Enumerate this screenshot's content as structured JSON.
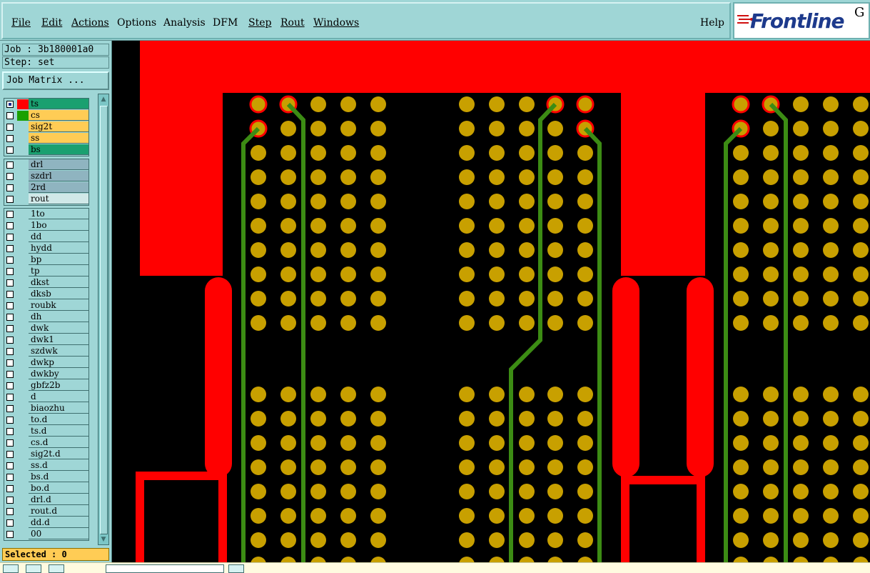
{
  "menu": {
    "items": [
      {
        "label": "File",
        "mnemonic": true
      },
      {
        "label": "Edit",
        "mnemonic": true
      },
      {
        "label": "Actions",
        "mnemonic": true
      },
      {
        "label": "Options",
        "mnemonic": false
      },
      {
        "label": "Analysis",
        "mnemonic": false
      },
      {
        "label": "DFM",
        "mnemonic": false
      },
      {
        "label": "Step",
        "mnemonic": true
      },
      {
        "label": "Rout",
        "mnemonic": true
      },
      {
        "label": "Windows",
        "mnemonic": true
      }
    ],
    "help_label": "Help"
  },
  "logo": {
    "text": "Frontline",
    "suffix": "G"
  },
  "info": {
    "job_line": "Job : 3b180001a0",
    "step_line": "Step: set",
    "job_matrix_label": "Job Matrix ..."
  },
  "layers": {
    "group1": [
      {
        "name": "ts",
        "bg": "#1aa070",
        "swatch": "#ff0000",
        "selected": true
      },
      {
        "name": "cs",
        "bg": "#ffcc55",
        "swatch": "#1aa000",
        "selected": false
      },
      {
        "name": "sig2t",
        "bg": "#ffcc55",
        "swatch": "",
        "selected": false
      },
      {
        "name": "ss",
        "bg": "#ffcc55",
        "swatch": "",
        "selected": false
      },
      {
        "name": "bs",
        "bg": "#1aa070",
        "swatch": "",
        "selected": false
      }
    ],
    "group2": [
      {
        "name": "drl",
        "bg": "#8fb4c0"
      },
      {
        "name": "szdrl",
        "bg": "#8fb4c0"
      },
      {
        "name": "2rd",
        "bg": "#8fb4c0"
      },
      {
        "name": "rout",
        "bg": "#d0e8e8"
      }
    ],
    "group3": [
      {
        "name": "1to"
      },
      {
        "name": "1bo"
      },
      {
        "name": "dd"
      },
      {
        "name": "hydd"
      },
      {
        "name": "bp"
      },
      {
        "name": "tp"
      },
      {
        "name": "dkst"
      },
      {
        "name": "dksb"
      },
      {
        "name": "roubk"
      },
      {
        "name": "dh"
      },
      {
        "name": "dwk"
      },
      {
        "name": "dwk1"
      },
      {
        "name": "szdwk"
      },
      {
        "name": "dwkp"
      },
      {
        "name": "dwkby"
      },
      {
        "name": "gbfz2b"
      },
      {
        "name": "d"
      },
      {
        "name": "biaozhu"
      },
      {
        "name": "to.d"
      },
      {
        "name": "ts.d"
      },
      {
        "name": "cs.d"
      },
      {
        "name": "sig2t.d"
      },
      {
        "name": "ss.d"
      },
      {
        "name": "bs.d"
      },
      {
        "name": "bo.d"
      },
      {
        "name": "drl.d"
      },
      {
        "name": "rout.d"
      },
      {
        "name": "dd.d"
      },
      {
        "name": "00"
      }
    ]
  },
  "status": {
    "selected_text": "Selected : 0"
  },
  "colors": {
    "panel_bg": "#9fd6d6",
    "copper": "#ff0000",
    "pad_fill": "#c8a000",
    "trace": "#3c8c14",
    "canvas_bg": "#000000"
  },
  "icons": {
    "logo_mark": "frontline-logo-icon",
    "scroll_up": "scroll-up-arrow-icon",
    "scroll_down": "scroll-down-arrow-icon"
  }
}
